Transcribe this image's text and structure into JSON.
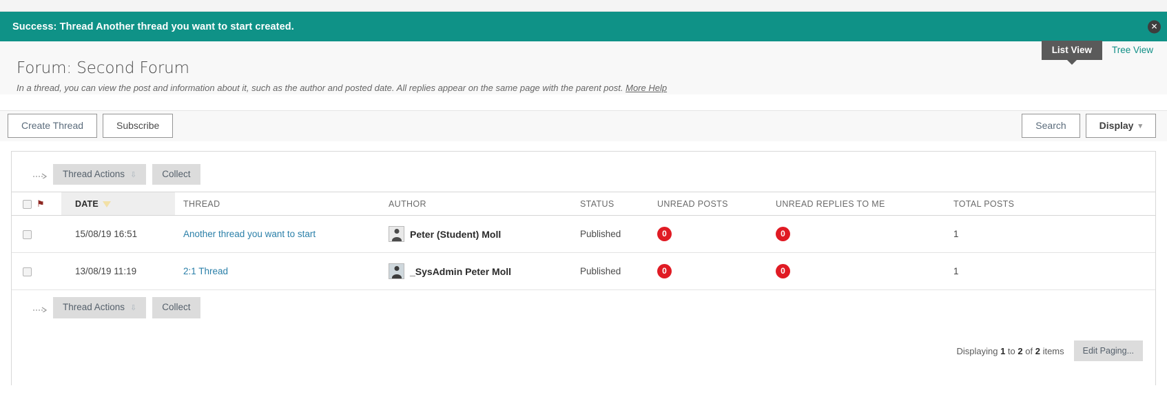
{
  "banner": {
    "message": "Success: Thread Another thread you want to start created.",
    "close_label": "✕",
    "bg_color": "#0f9287"
  },
  "view_tabs": {
    "active": "List View",
    "inactive": "Tree View"
  },
  "header": {
    "title": "Forum: Second Forum",
    "instructions": "In a thread, you can view the post and information about it, such as the author and posted date. All replies appear on the same page with the parent post.",
    "more_help": "More Help"
  },
  "action_bar": {
    "create_thread": "Create Thread",
    "subscribe": "Subscribe",
    "search": "Search",
    "display": "Display",
    "display_chevron": "⌄"
  },
  "toolbar": {
    "thread_actions": "Thread Actions",
    "collect": "Collect",
    "double_chevron": "ˇˇ"
  },
  "table": {
    "columns": [
      {
        "label": "",
        "key": "check"
      },
      {
        "label": "",
        "key": "flag"
      },
      {
        "label": "DATE",
        "key": "date",
        "sorted": true
      },
      {
        "label": "THREAD",
        "key": "thread"
      },
      {
        "label": "AUTHOR",
        "key": "author"
      },
      {
        "label": "STATUS",
        "key": "status"
      },
      {
        "label": "UNREAD POSTS",
        "key": "unread_posts"
      },
      {
        "label": "UNREAD REPLIES TO ME",
        "key": "unread_replies"
      },
      {
        "label": "TOTAL POSTS",
        "key": "total_posts"
      }
    ],
    "rows": [
      {
        "date": "15/08/19 16:51",
        "thread": "Another thread you want to start",
        "author": "Peter (Student) Moll",
        "status": "Published",
        "unread_posts": "0",
        "unread_replies": "0",
        "total_posts": "1"
      },
      {
        "date": "13/08/19 11:19",
        "thread": "2:1 Thread",
        "author": "_SysAdmin Peter Moll",
        "status": "Published",
        "unread_posts": "0",
        "unread_replies": "0",
        "total_posts": "1"
      }
    ]
  },
  "paging": {
    "prefix": "Displaying",
    "from": "1",
    "mid": "to",
    "to": "2",
    "of": "of",
    "total": "2",
    "suffix": "items",
    "edit_paging": "Edit Paging..."
  },
  "colors": {
    "accent_teal": "#0f9287",
    "link_blue": "#2a7fa8",
    "badge_red": "#e01b24"
  }
}
